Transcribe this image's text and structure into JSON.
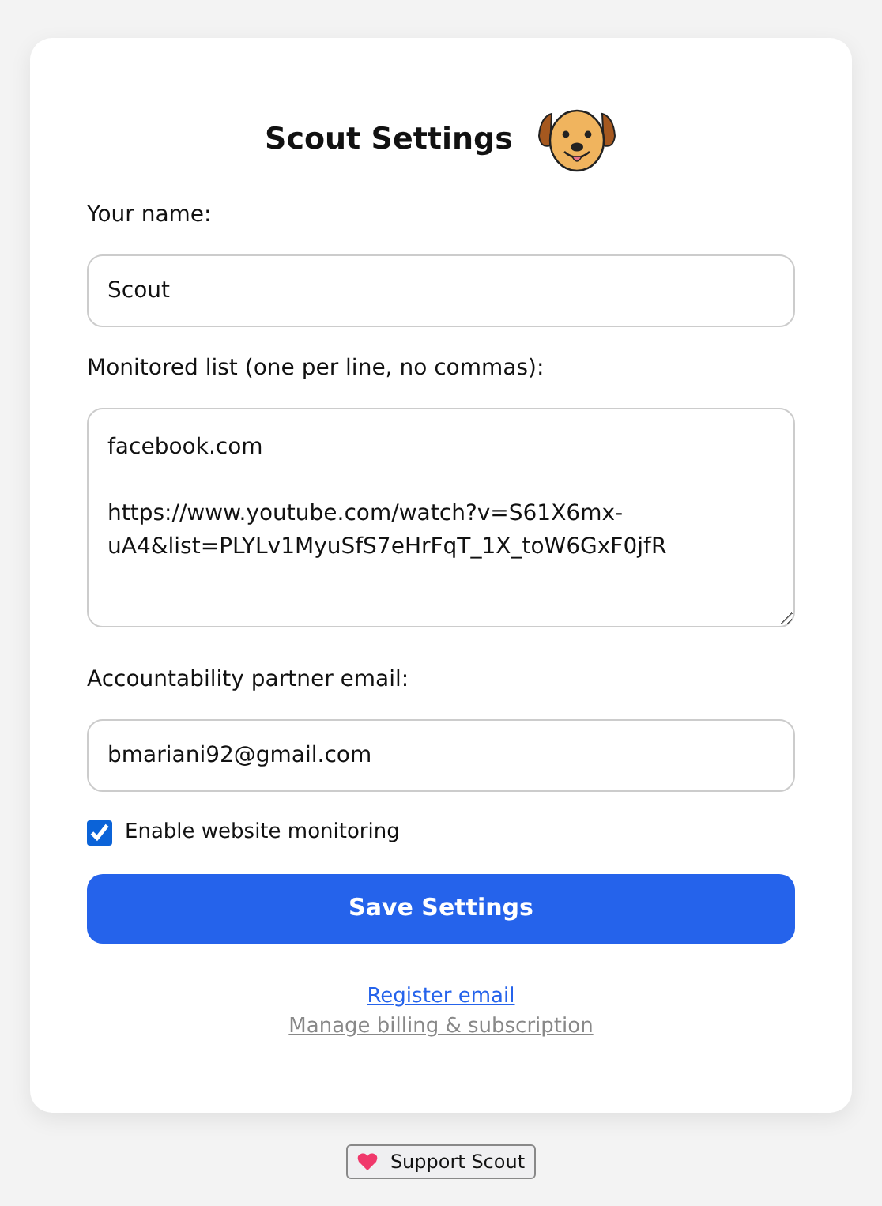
{
  "title": "Scout Settings",
  "fields": [
    {
      "kind": "input",
      "label": "Your name:",
      "value": "Scout"
    },
    {
      "kind": "textarea",
      "label": "Monitored list (one per line, no commas):",
      "value": "facebook.com\n\nhttps://www.youtube.com/watch?v=S61X6mx-uA4&list=PLYLv1MyuSfS7eHrFqT_1X_toW6GxF0jfR"
    },
    {
      "kind": "input",
      "label": "Accountability partner email:",
      "value": "bmariani92@gmail.com"
    }
  ],
  "monitoring": {
    "label": "Enable website monitoring",
    "checked": true
  },
  "save_button": "Save Settings",
  "links": [
    {
      "label": "Register email",
      "kind": "primary"
    },
    {
      "label": "Manage billing & subscription",
      "kind": "muted"
    }
  ],
  "support_button": "Support Scout"
}
